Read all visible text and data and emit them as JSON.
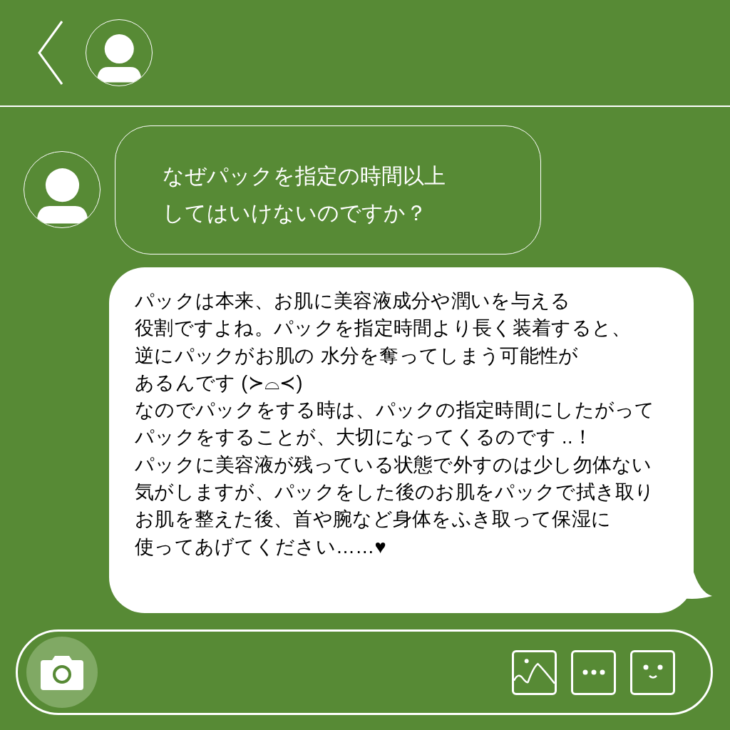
{
  "incoming_message": {
    "lines": [
      "なぜパックを指定の時間以上",
      "してはいけないのですか？"
    ]
  },
  "outgoing_message": {
    "lines": [
      "パックは本来、お肌に美容液成分や潤いを与える",
      "役割ですよね。パックを指定時間より長く装着すると、",
      "逆にパックがお肌の 水分を奪ってしまう可能性が",
      "あるんです (≻⌓≺)",
      "なのでパックをする時は、パックの指定時間にしたがって",
      "パックをすることが、大切になってくるのです ..！",
      "パックに美容液が残っている状態で外すのは少し勿体ない",
      "気がしますが、パックをした後のお肌をパックで拭き取り",
      "お肌を整えた後、首や腕など身体をふき取って保湿に",
      "使ってあげてください……♥"
    ]
  }
}
